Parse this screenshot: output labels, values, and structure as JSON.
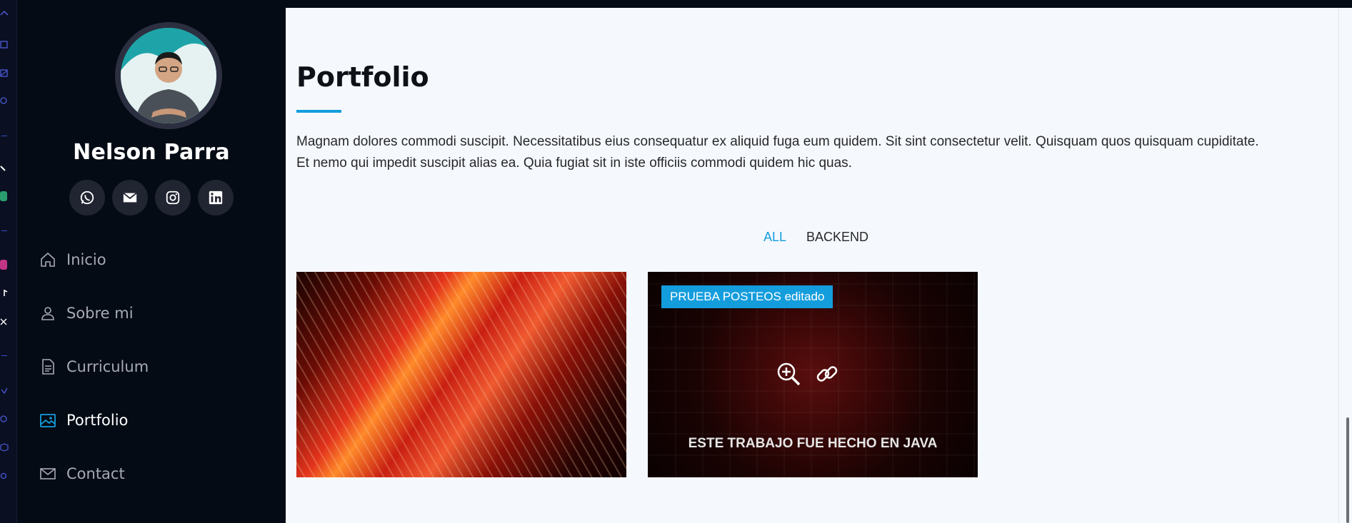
{
  "sidebar": {
    "name": "Nelson Parra",
    "social": [
      "whatsapp-icon",
      "envelope-icon",
      "instagram-icon",
      "linkedin-icon"
    ],
    "nav": [
      {
        "label": "Inicio",
        "icon": "house-icon",
        "active": false
      },
      {
        "label": "Sobre mi",
        "icon": "person-icon",
        "active": false
      },
      {
        "label": "Curriculum",
        "icon": "file-icon",
        "active": false
      },
      {
        "label": "Portfolio",
        "icon": "images-icon",
        "active": true
      },
      {
        "label": "Contact",
        "icon": "envelope-icon",
        "active": false
      }
    ]
  },
  "portfolio": {
    "title": "Portfolio",
    "description_line1": "Magnam dolores commodi suscipit. Necessitatibus eius consequatur ex aliquid fuga eum quidem. Sit sint consectetur velit. Quisquam quos quisquam cupiditate.",
    "description_line2": "Et nemo qui impedit suscipit alias ea. Quia fugiat sit in iste officiis commodi quidem hic quas.",
    "filters": [
      {
        "label": "ALL",
        "active": true
      },
      {
        "label": "BACKEND",
        "active": false
      }
    ],
    "items": [
      {
        "tag": "",
        "caption": ""
      },
      {
        "tag": "PRUEBA POSTEOS editado",
        "caption": "ESTE TRABAJO FUE HECHO EN JAVA"
      }
    ]
  },
  "colors": {
    "accent": "#149ddd",
    "sidebar_bg": "#040b14",
    "content_bg": "#f5f8fd",
    "social_bg": "#212431"
  }
}
